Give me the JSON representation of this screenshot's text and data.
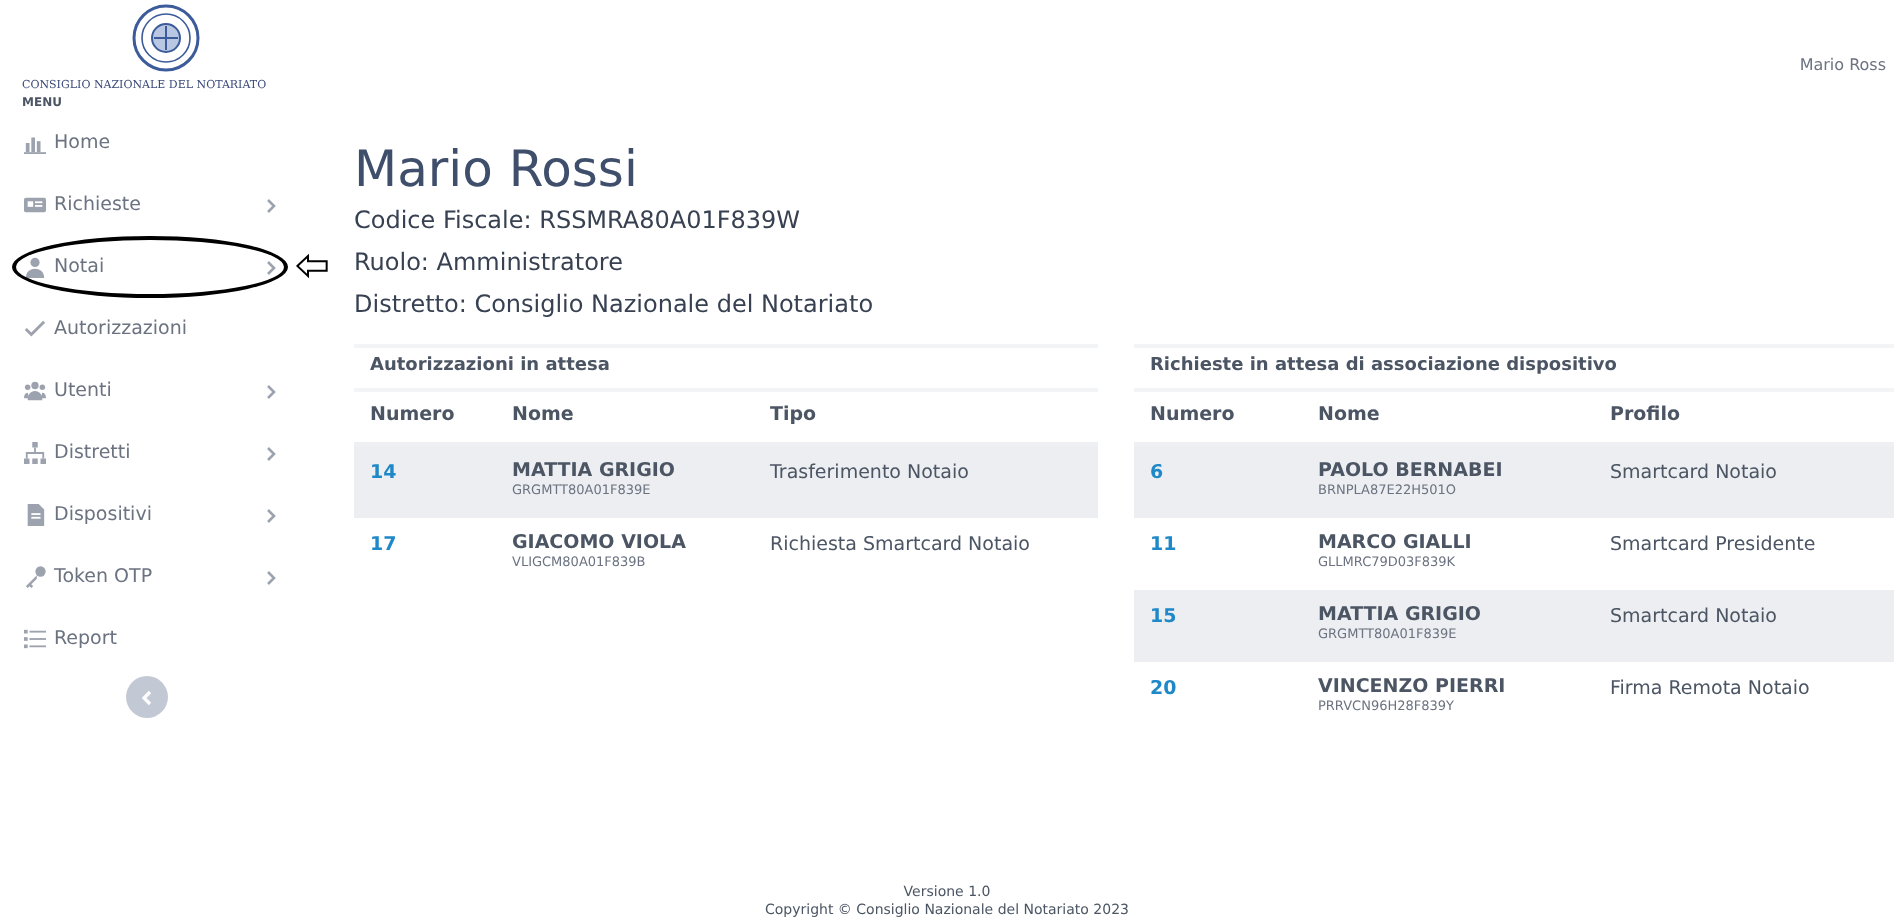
{
  "header": {
    "logo_text": "CONSIGLIO NAZIONALE DEL NOTARIATO",
    "user": "Mario Ross"
  },
  "sidebar": {
    "heading": "MENU",
    "items": [
      {
        "label": "Home",
        "has_submenu": false,
        "annotated": false
      },
      {
        "label": "Richieste",
        "has_submenu": true,
        "annotated": false
      },
      {
        "label": "Notai",
        "has_submenu": true,
        "annotated": true
      },
      {
        "label": "Autorizzazioni",
        "has_submenu": false,
        "annotated": false
      },
      {
        "label": "Utenti",
        "has_submenu": true,
        "annotated": false
      },
      {
        "label": "Distretti",
        "has_submenu": true,
        "annotated": false
      },
      {
        "label": "Dispositivi",
        "has_submenu": true,
        "annotated": false
      },
      {
        "label": "Token OTP",
        "has_submenu": true,
        "annotated": false
      },
      {
        "label": "Report",
        "has_submenu": false,
        "annotated": false
      }
    ]
  },
  "profile": {
    "name": "Mario Rossi",
    "fields": [
      {
        "label": "Codice Fiscale:",
        "value": "RSSMRA80A01F839W"
      },
      {
        "label": "Ruolo:",
        "value": "Amministratore"
      },
      {
        "label": "Distretto:",
        "value": "Consiglio Nazionale del Notariato"
      }
    ]
  },
  "tables": [
    {
      "title": "Autorizzazioni in attesa",
      "columns": [
        "Numero",
        "Nome",
        "Tipo"
      ],
      "rows": [
        {
          "number": "14",
          "name": "MATTIA GRIGIO",
          "code": "GRGMTT80A01F839E",
          "type": "Trasferimento Notaio"
        },
        {
          "number": "17",
          "name": "GIACOMO VIOLA",
          "code": "VLIGCM80A01F839B",
          "type": "Richiesta Smartcard Notaio"
        }
      ]
    },
    {
      "title": "Richieste in attesa di associazione dispositivo",
      "columns": [
        "Numero",
        "Nome",
        "Profilo"
      ],
      "rows": [
        {
          "number": "6",
          "name": "PAOLO BERNABEI",
          "code": "BRNPLA87E22H501O",
          "type": "Smartcard Notaio"
        },
        {
          "number": "11",
          "name": "MARCO GIALLI",
          "code": "GLLMRC79D03F839K",
          "type": "Smartcard Presidente"
        },
        {
          "number": "15",
          "name": "MATTIA GRIGIO",
          "code": "GRGMTT80A01F839E",
          "type": "Smartcard Notaio"
        },
        {
          "number": "20",
          "name": "VINCENZO PIERRI",
          "code": "PRRVCN96H28F839Y",
          "type": "Firma Remota Notaio"
        }
      ]
    }
  ],
  "footer": {
    "version": "Versione 1.0",
    "copyright": "Copyright © Consiglio Nazionale del Notariato 2023"
  }
}
